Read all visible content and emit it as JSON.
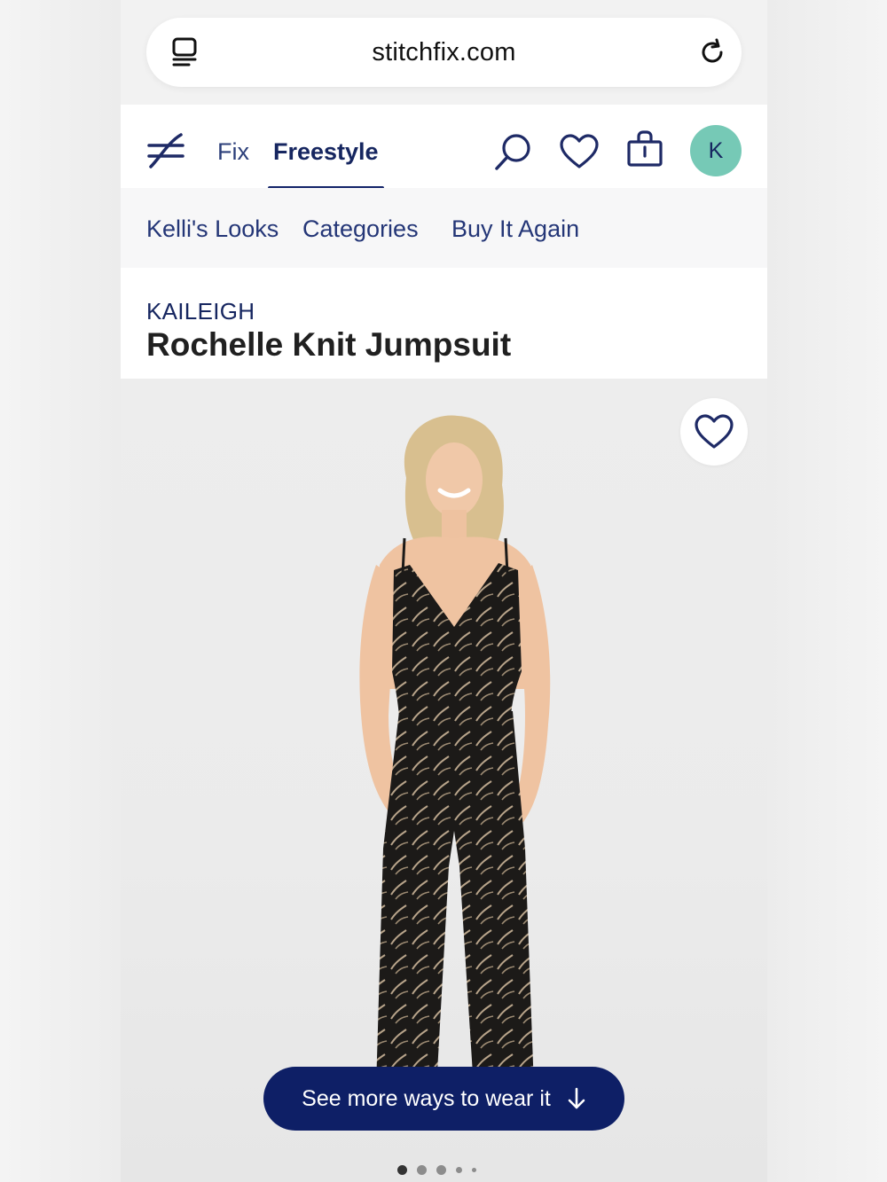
{
  "browser": {
    "url": "stitchfix.com",
    "tabs_icon": "tabs-icon",
    "reload_icon": "reload-icon"
  },
  "nav": {
    "logo_icon": "stitchfix-logo-icon",
    "tabs": [
      {
        "label": "Fix",
        "active": false
      },
      {
        "label": "Freestyle",
        "active": true
      }
    ],
    "icons": [
      "search-icon",
      "heart-icon",
      "shopping-bag-icon"
    ],
    "avatar_initial": "K"
  },
  "subnav": {
    "items": [
      "Kelli's Looks",
      "Categories",
      "Buy It Again"
    ]
  },
  "product": {
    "brand": "KAILEIGH",
    "name": "Rochelle Knit Jumpsuit",
    "favorite_icon": "heart-icon",
    "cta_label": "See more ways to wear it",
    "cta_icon": "arrow-down-icon",
    "carousel": {
      "count": 5,
      "active": 1
    }
  },
  "colors": {
    "navy": "#0e1f66",
    "avatar_teal": "#76c9b6",
    "link_blue": "#243677"
  }
}
